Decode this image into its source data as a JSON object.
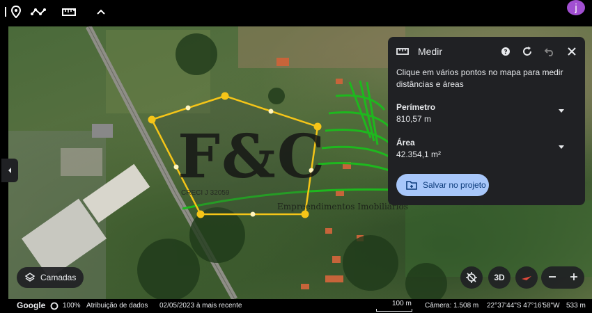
{
  "panel": {
    "title": "Medir",
    "instruction": "Clique em vários pontos no mapa para medir distâncias e áreas",
    "perimeter_label": "Perímetro",
    "perimeter_value": "810,57 m",
    "area_label": "Área",
    "area_value": "42.354,1 m²",
    "save_label": "Salvar no projeto"
  },
  "user": {
    "avatar_letter": "j"
  },
  "layers": {
    "label": "Camadas"
  },
  "controls": {
    "view_3d": "3D"
  },
  "watermark": {
    "logo": "F&C",
    "creci": "CRECI J 32059",
    "subtitle": "Empreendimentos Imobiliários"
  },
  "status": {
    "brand": "Google",
    "zoom": "100%",
    "attribution": "Atribuição de dados",
    "imagery_date": "02/05/2023 à mais recente",
    "scale": "100 m",
    "camera": "Câmera: 1.508 m",
    "coordinates": "22°37'44\"S 47°16'58\"W",
    "elevation": "533 m"
  },
  "colors": {
    "polygon": "#f5c518",
    "panel_bg": "#202124",
    "save_button": "#a8c7fa",
    "avatar": "#a14fd1"
  }
}
